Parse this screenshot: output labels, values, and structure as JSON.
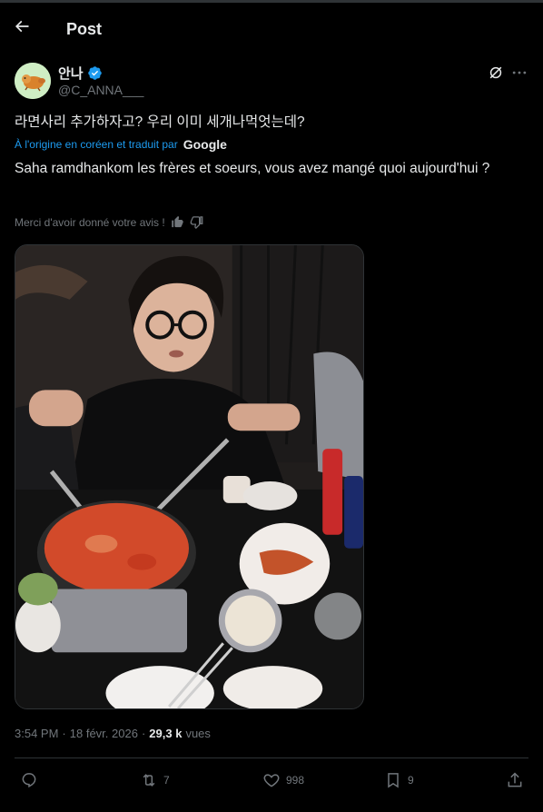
{
  "header": {
    "title": "Post"
  },
  "author": {
    "name": "안나",
    "handle": "@C_ANNA___",
    "verified": true
  },
  "post": {
    "original_text": "라면사리 추가하자고? 우리 이미 세개나먹엇는데?",
    "translation_note": "À l'origine en coréen et traduit par",
    "translation_provider": "Google",
    "translated_text": "Saha ramdhankom les frères et soeurs, vous avez mangé quoi aujourd'hui ?",
    "feedback_prompt": "Merci d'avoir donné votre avis !"
  },
  "meta": {
    "time": "3:54 PM",
    "separator1": "·",
    "date": "18 févr. 2026",
    "separator2": "·",
    "views_count": "29,3 k",
    "views_label": "vues"
  },
  "actions": {
    "replies": "",
    "reposts": "7",
    "likes": "998",
    "bookmarks": "9"
  },
  "colors": {
    "accent": "#1d9bf0",
    "muted": "#71767b",
    "text": "#e7e9ea",
    "background": "#000000"
  }
}
